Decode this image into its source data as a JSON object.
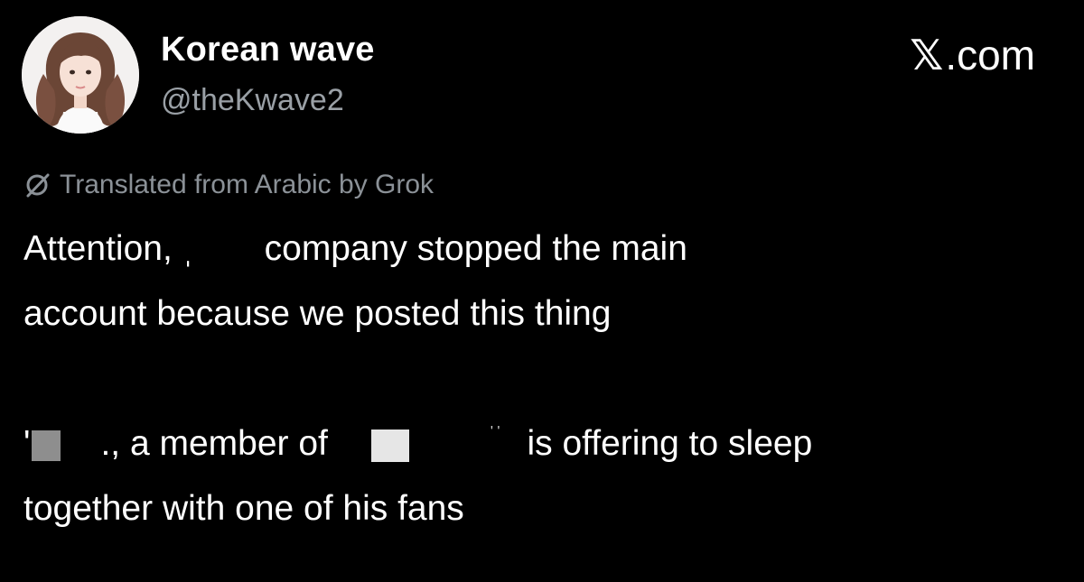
{
  "header": {
    "display_name": "Korean wave",
    "handle": "@theKwave2",
    "brand": ".com",
    "brand_mark_icon": "x-logo-icon"
  },
  "translation_notice": {
    "icon": "grok-icon",
    "text": "Translated from Arabic by Grok"
  },
  "post": {
    "line1_start": "Attention, ",
    "line1_fragment_a": "ˌ",
    "line1_fragment_b": "company stopped the main",
    "line2": "account because we posted this thing",
    "line3_fragment_a": "'",
    "line3_fragment_b": "., a member of",
    "line3_fragment_c": "' '",
    "line3_end": "is offering to sleep",
    "line4": "together with one of his fans"
  },
  "colors": {
    "background": "#000000",
    "text_primary": "#ffffff",
    "text_secondary": "#9aa0a6",
    "redaction_pixel_dark": "#8e8e8e",
    "redaction_pixel_light": "#e6e6e6"
  }
}
